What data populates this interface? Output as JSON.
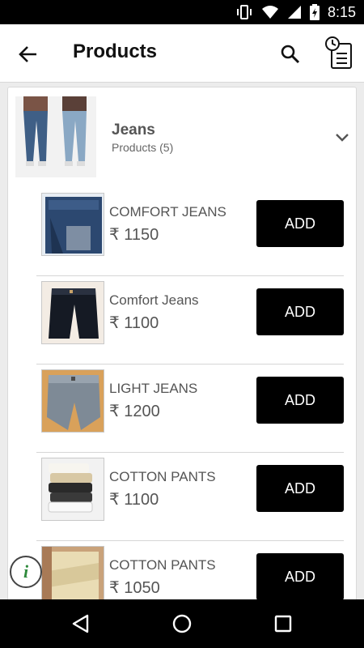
{
  "status_bar": {
    "time": "8:15"
  },
  "header": {
    "title": "Products"
  },
  "category": {
    "name": "Jeans",
    "subtitle": "Products (5)"
  },
  "products": [
    {
      "name": "COMFORT JEANS",
      "price": "₹ 1150",
      "button": "ADD"
    },
    {
      "name": "Comfort Jeans",
      "price": "₹ 1100",
      "button": "ADD"
    },
    {
      "name": "LIGHT JEANS",
      "price": "₹ 1200",
      "button": "ADD"
    },
    {
      "name": "COTTON PANTS",
      "price": "₹ 1100",
      "button": "ADD"
    },
    {
      "name": "COTTON PANTS",
      "price": "₹ 1050",
      "button": "ADD"
    }
  ],
  "info_fab": {
    "glyph": "i"
  },
  "icons": {
    "back": "arrow-left-icon",
    "search": "search-icon",
    "history": "order-history-icon",
    "expand": "chevron-down-icon",
    "nav_back": "nav-back-icon",
    "nav_home": "nav-home-icon",
    "nav_recents": "nav-recents-icon"
  },
  "colors": {
    "button_bg": "#000000",
    "info_icon": "#2f8a3c"
  }
}
